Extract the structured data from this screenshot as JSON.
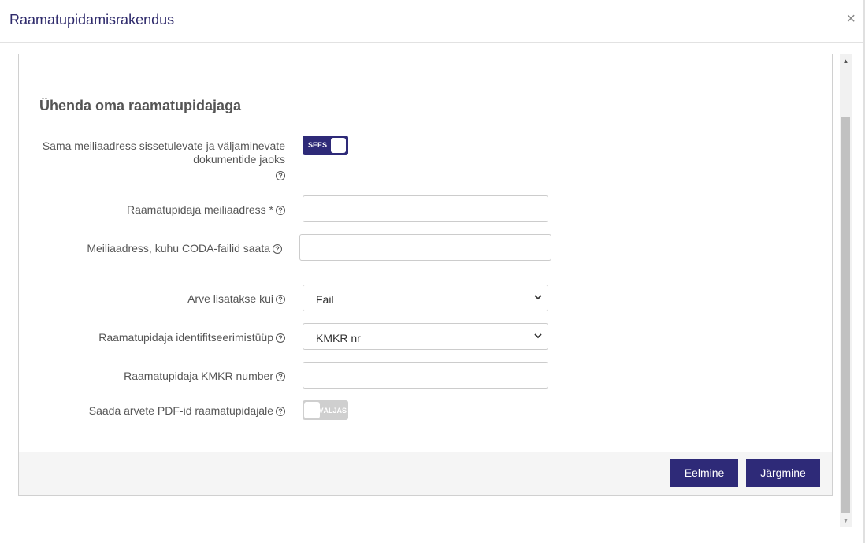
{
  "header": {
    "title": "Raamatupidamisrakendus",
    "close_label": "×"
  },
  "section": {
    "title": "Ühenda oma raamatupidajaga"
  },
  "fields": {
    "same_email": {
      "label_line1": "Sama meiliaadress sissetulevate ja väljaminevate",
      "label_line2": "dokumentide jaoks",
      "toggle_text": "SEES"
    },
    "accountant_email": {
      "label": "Raamatupidaja meiliaadress *",
      "value": ""
    },
    "coda_email": {
      "label": "Meiliaadress, kuhu CODA-failid saata",
      "value": ""
    },
    "invoice_added_as": {
      "label": "Arve lisatakse kui",
      "selected": "Fail"
    },
    "identification_type": {
      "label": "Raamatupidaja identifitseerimistüüp",
      "selected": "KMKR nr"
    },
    "kmkr_number": {
      "label": "Raamatupidaja KMKR number",
      "value": ""
    },
    "send_pdf": {
      "label": "Saada arvete PDF-id raamatupidajale",
      "toggle_text": "VÄLJAS"
    }
  },
  "help_glyph": "?",
  "footer": {
    "previous_label": "Eelmine",
    "next_label": "Järgmine"
  },
  "scrollbar": {
    "up": "▲",
    "down": "▼"
  },
  "colors": {
    "accent": "#2e2a78",
    "title": "#2e2a6b",
    "toggle_off": "#cfcfcf"
  }
}
